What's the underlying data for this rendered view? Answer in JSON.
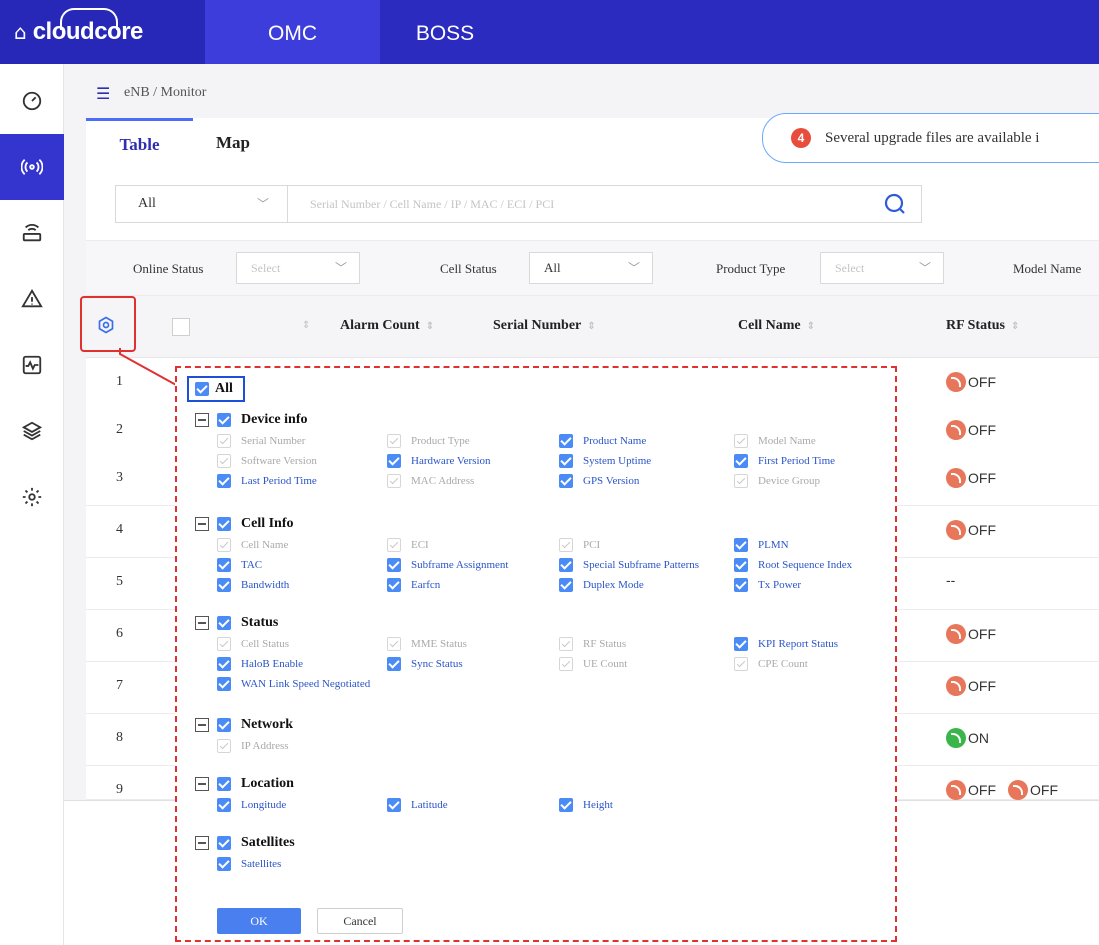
{
  "header": {
    "logo_text": "cloudcore",
    "tabs": [
      "OMC",
      "BOSS"
    ]
  },
  "nav": {
    "icons": [
      "dashboard-icon",
      "antenna-icon",
      "router-icon",
      "alarm-icon",
      "performance-icon",
      "layers-icon",
      "settings-icon"
    ],
    "active_index": 1,
    "accent_color": "#3434cf"
  },
  "breadcrumb": "eNB / Monitor",
  "view_tabs": {
    "table": "Table",
    "map": "Map"
  },
  "notice": {
    "count": "4",
    "text": "Several upgrade files are available i"
  },
  "search": {
    "scope": "All",
    "placeholder": "Serial Number / Cell Name / IP / MAC / ECI / PCI"
  },
  "filters": {
    "online_status_label": "Online Status",
    "online_status_value": "Select",
    "cell_status_label": "Cell Status",
    "cell_status_value": "All",
    "product_type_label": "Product Type",
    "product_type_value": "Select",
    "model_name_label": "Model Name"
  },
  "table": {
    "columns": {
      "alarm_count": "Alarm Count",
      "serial_number": "Serial Number",
      "cell_name": "Cell Name",
      "rf_status": "RF Status"
    },
    "rows": [
      {
        "num": "1",
        "rf": [
          "OFF"
        ]
      },
      {
        "num": "2",
        "rf": [
          "OFF"
        ]
      },
      {
        "num": "3",
        "rf": [
          "OFF"
        ]
      },
      {
        "num": "4",
        "rf": [
          "OFF"
        ]
      },
      {
        "num": "5",
        "rf_text": "--"
      },
      {
        "num": "6",
        "rf": [
          "OFF"
        ]
      },
      {
        "num": "7",
        "rf": [
          "OFF"
        ]
      },
      {
        "num": "8",
        "rf": [
          "ON"
        ]
      },
      {
        "num": "9",
        "rf": [
          "OFF",
          "OFF"
        ]
      }
    ]
  },
  "column_picker": {
    "all_label": "All",
    "groups": [
      {
        "title": "Device info",
        "items": [
          {
            "label": "Serial Number",
            "state": "dis"
          },
          {
            "label": "Product Type",
            "state": "dis"
          },
          {
            "label": "Product Name",
            "state": "on"
          },
          {
            "label": "Model Name",
            "state": "dis"
          },
          {
            "label": "Software Version",
            "state": "dis"
          },
          {
            "label": "Hardware Version",
            "state": "on"
          },
          {
            "label": "System Uptime",
            "state": "on"
          },
          {
            "label": "First Period Time",
            "state": "on"
          },
          {
            "label": "Last Period Time",
            "state": "on"
          },
          {
            "label": "MAC Address",
            "state": "dis"
          },
          {
            "label": "GPS Version",
            "state": "on"
          },
          {
            "label": "Device Group",
            "state": "dis"
          }
        ]
      },
      {
        "title": "Cell Info",
        "items": [
          {
            "label": "Cell Name",
            "state": "dis"
          },
          {
            "label": "ECI",
            "state": "dis"
          },
          {
            "label": "PCI",
            "state": "dis"
          },
          {
            "label": "PLMN",
            "state": "on"
          },
          {
            "label": "TAC",
            "state": "on"
          },
          {
            "label": "Subframe Assignment",
            "state": "on"
          },
          {
            "label": "Special Subframe Patterns",
            "state": "on"
          },
          {
            "label": "Root Sequence Index",
            "state": "on"
          },
          {
            "label": "Bandwidth",
            "state": "on"
          },
          {
            "label": "Earfcn",
            "state": "on"
          },
          {
            "label": "Duplex Mode",
            "state": "on"
          },
          {
            "label": "Tx Power",
            "state": "on"
          }
        ]
      },
      {
        "title": "Status",
        "items": [
          {
            "label": "Cell Status",
            "state": "dis"
          },
          {
            "label": "MME Status",
            "state": "dis"
          },
          {
            "label": "RF Status",
            "state": "dis"
          },
          {
            "label": "KPI Report Status",
            "state": "on"
          },
          {
            "label": "HaloB Enable",
            "state": "on"
          },
          {
            "label": "Sync Status",
            "state": "on"
          },
          {
            "label": "UE Count",
            "state": "dis"
          },
          {
            "label": "CPE Count",
            "state": "dis"
          },
          {
            "label": "WAN Link Speed Negotiated",
            "state": "on"
          }
        ]
      },
      {
        "title": "Network",
        "items": [
          {
            "label": "IP Address",
            "state": "dis"
          }
        ]
      },
      {
        "title": "Location",
        "items": [
          {
            "label": "Longitude",
            "state": "on"
          },
          {
            "label": "Latitude",
            "state": "on"
          },
          {
            "label": "Height",
            "state": "on"
          }
        ]
      },
      {
        "title": "Satellites",
        "items": [
          {
            "label": "Satellites",
            "state": "on"
          }
        ]
      }
    ],
    "ok_label": "OK",
    "cancel_label": "Cancel"
  }
}
